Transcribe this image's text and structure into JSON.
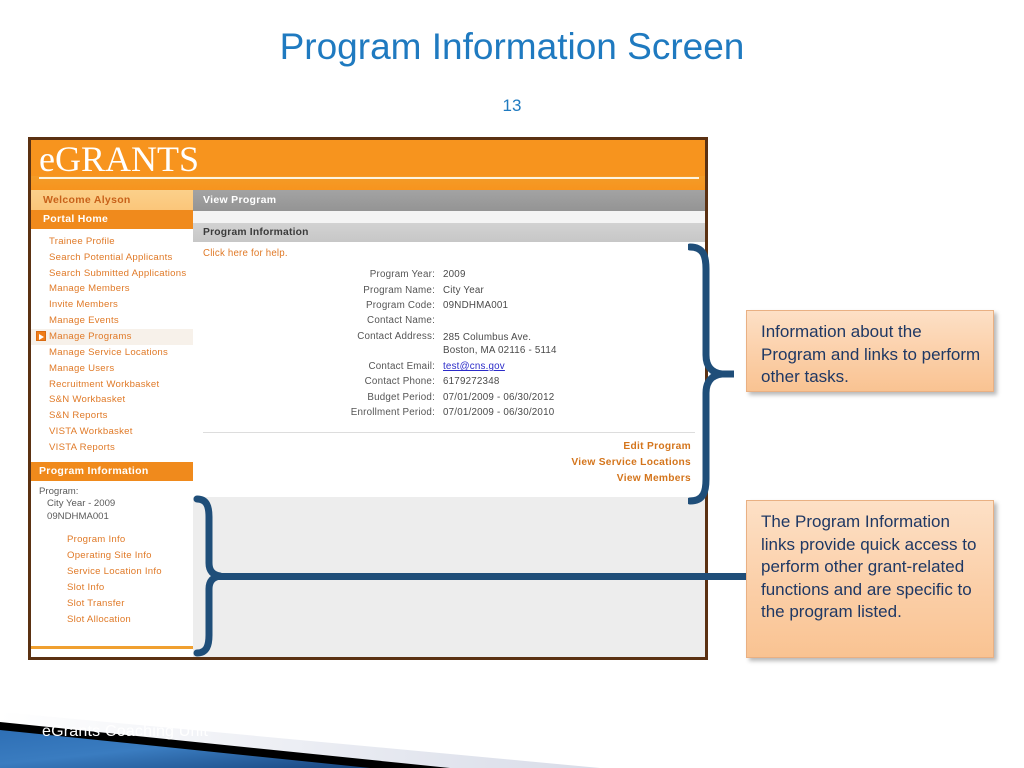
{
  "slide": {
    "title": "Program Information Screen",
    "number": "13",
    "footer_label": "eGrants Coaching Unit",
    "accent_blue": "#1F7AC0",
    "connector_blue": "#1F4E79",
    "brand_orange": "#F7941E",
    "callout_bg": "#FBCFA8",
    "callout_text_color": "#1F3864"
  },
  "app": {
    "brand": {
      "prefix": "e",
      "name": "GRANTS"
    },
    "sidebar": {
      "welcome": "Welcome Alyson",
      "portal_home": "Portal Home",
      "nav_items": [
        {
          "label": "Trainee Profile",
          "icon": "",
          "current": false
        },
        {
          "label": "Search Potential Applicants",
          "icon": "",
          "current": false
        },
        {
          "label": "Search Submitted Applications",
          "icon": "",
          "current": false
        },
        {
          "label": "Manage Members",
          "icon": "",
          "current": false
        },
        {
          "label": "Invite Members",
          "icon": "",
          "current": false
        },
        {
          "label": "Manage Events",
          "icon": "",
          "current": false
        },
        {
          "label": "Manage Programs",
          "icon": "arrow-right-icon",
          "current": true
        },
        {
          "label": "Manage Service Locations",
          "icon": "",
          "current": false
        },
        {
          "label": "Manage Users",
          "icon": "",
          "current": false
        },
        {
          "label": "Recruitment Workbasket",
          "icon": "",
          "current": false
        },
        {
          "label": "S&N Workbasket",
          "icon": "",
          "current": false
        },
        {
          "label": "S&N Reports",
          "icon": "",
          "current": false
        },
        {
          "label": "VISTA Workbasket",
          "icon": "",
          "current": false
        },
        {
          "label": "VISTA Reports",
          "icon": "",
          "current": false
        }
      ],
      "program_information": {
        "header": "Program Information",
        "program_label": "Program:",
        "program_name": "City Year - 2009",
        "program_code": "09NDHMA001",
        "links": [
          "Program Info",
          "Operating Site Info",
          "Service Location Info",
          "Slot Info",
          "Slot Transfer",
          "Slot Allocation"
        ]
      }
    },
    "content": {
      "page_bar": "View Program",
      "panel_header": "Program Information",
      "help_link": "Click here for help.",
      "fields": [
        {
          "label": "Program Year:",
          "value": "2009",
          "type": "text"
        },
        {
          "label": "Program Name:",
          "value": "City Year",
          "type": "text"
        },
        {
          "label": "Program Code:",
          "value": "09NDHMA001",
          "type": "text"
        },
        {
          "label": "Contact Name:",
          "value": "",
          "type": "text"
        },
        {
          "label": "Contact Address:",
          "value": "285 Columbus Ave.",
          "value2": "Boston, MA 02116 - 5114",
          "type": "address"
        },
        {
          "label": "Contact Email:",
          "value": "test@cns.gov",
          "type": "link"
        },
        {
          "label": "Contact Phone:",
          "value": "6179272348",
          "type": "text"
        },
        {
          "label": "Budget Period:",
          "value": "07/01/2009 - 06/30/2012",
          "type": "text"
        },
        {
          "label": "Enrollment Period:",
          "value": "07/01/2009 - 06/30/2010",
          "type": "text"
        }
      ],
      "action_links": [
        "Edit Program",
        "View Service Locations",
        "View Members"
      ]
    }
  },
  "callouts": [
    {
      "text": "Information about the Program and links to perform other tasks."
    },
    {
      "text": "The Program Information links provide quick access to perform other grant-related functions and are specific to the program listed."
    }
  ]
}
